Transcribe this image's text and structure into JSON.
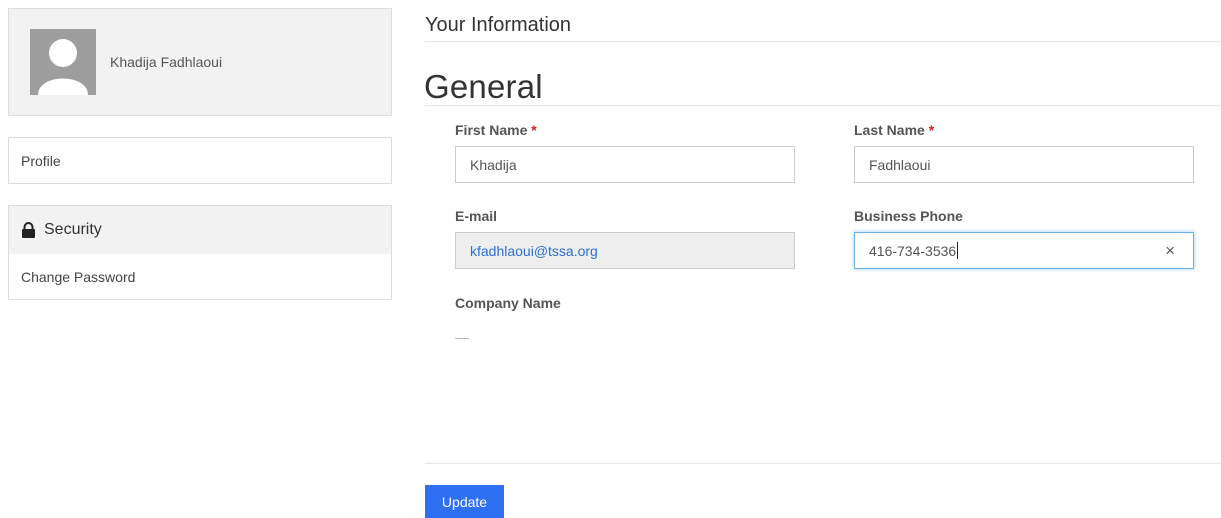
{
  "user": {
    "name": "Khadija Fadhlaoui"
  },
  "sidebar": {
    "profile_label": "Profile",
    "security": {
      "header": "Security",
      "items": [
        {
          "label": "Change Password"
        }
      ]
    }
  },
  "main": {
    "section_title": "Your Information",
    "subsection_title": "General",
    "fields": {
      "first_name": {
        "label": "First Name",
        "required_mark": "*",
        "value": "Khadija"
      },
      "last_name": {
        "label": "Last Name",
        "required_mark": "*",
        "value": "Fadhlaoui"
      },
      "email": {
        "label": "E-mail",
        "value": "kfadhlaoui@tssa.org"
      },
      "business_phone": {
        "label": "Business Phone",
        "value": "416-734-3536",
        "clear_glyph": "×"
      },
      "company_name": {
        "label": "Company Name",
        "value": "—"
      }
    },
    "update_label": "Update"
  },
  "colors": {
    "accent": "#2f6ff2",
    "required": "#cc2222",
    "link_value": "#2b6fd0",
    "panel_bg": "#f2f2f2"
  },
  "icons": {
    "avatar": "user-silhouette-icon",
    "lock": "lock-icon",
    "clear": "close-icon"
  }
}
